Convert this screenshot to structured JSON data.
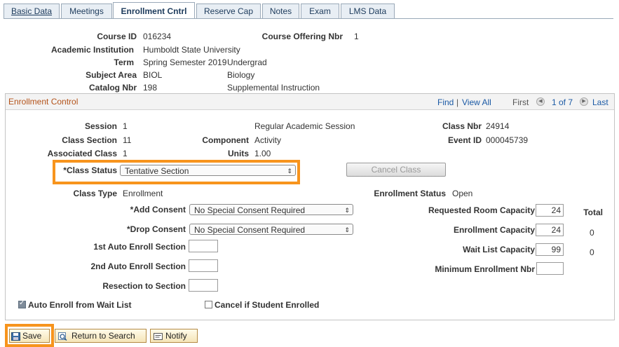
{
  "tabs": [
    "Basic Data",
    "Meetings",
    "Enrollment Cntrl",
    "Reserve Cap",
    "Notes",
    "Exam",
    "LMS Data"
  ],
  "header": {
    "course_id_label": "Course ID",
    "course_id": "016234",
    "offering_label": "Course Offering Nbr",
    "offering": "1",
    "institution_label": "Academic Institution",
    "institution": "Humboldt State University",
    "term_label": "Term",
    "term": "Spring Semester 2019",
    "term_career": "Undergrad",
    "subject_label": "Subject Area",
    "subject": "BIOL",
    "subject_desc": "Biology",
    "catalog_label": "Catalog Nbr",
    "catalog": "198",
    "catalog_desc": "Supplemental Instruction"
  },
  "panel": {
    "title": "Enrollment Control",
    "find": "Find",
    "sep": "|",
    "view_all": "View All",
    "first": "First",
    "range": "1 of 7",
    "last": "Last"
  },
  "fields": {
    "session_label": "Session",
    "session": "1",
    "session_desc": "Regular Academic Session",
    "class_nbr_label": "Class Nbr",
    "class_nbr": "24914",
    "class_section_label": "Class Section",
    "class_section": "11",
    "component_label": "Component",
    "component": "Activity",
    "event_id_label": "Event ID",
    "event_id": "000045739",
    "assoc_class_label": "Associated Class",
    "assoc_class": "1",
    "units_label": "Units",
    "units": "1.00",
    "class_status_label": "*Class Status",
    "class_status": "Tentative Section",
    "cancel_class": "Cancel Class",
    "class_type_label": "Class Type",
    "class_type": "Enrollment",
    "enroll_status_label": "Enrollment Status",
    "enroll_status": "Open",
    "add_consent_label": "*Add Consent",
    "add_consent": "No Special Consent Required",
    "drop_consent_label": "*Drop Consent",
    "drop_consent": "No Special Consent Required",
    "auto1_label": "1st Auto Enroll Section",
    "auto1": "",
    "auto2_label": "2nd Auto Enroll Section",
    "auto2": "",
    "resection_label": "Resection to Section",
    "resection": "",
    "req_room_label": "Requested Room Capacity",
    "req_room": "24",
    "enroll_cap_label": "Enrollment Capacity",
    "enroll_cap": "24",
    "waitlist_label": "Wait List Capacity",
    "waitlist": "99",
    "min_enroll_label": "Minimum Enrollment Nbr",
    "min_enroll": "",
    "total_label": "Total",
    "total_enroll": "0",
    "total_wait": "0",
    "auto_enroll_wait_label": "Auto Enroll from Wait List",
    "auto_enroll_wait_checked": true,
    "cancel_if_label": "Cancel if Student Enrolled",
    "cancel_if_checked": false
  },
  "toolbar": {
    "save": "Save",
    "return": "Return to Search",
    "notify": "Notify"
  },
  "colors": {
    "highlight": "#f7941d",
    "panel_title": "#b4531a",
    "link": "#1b5aa5"
  },
  "icons": [
    "save-icon",
    "search-icon",
    "notify-icon",
    "prev-arrow-icon",
    "next-arrow-icon",
    "dropdown-arrow-icon",
    "checkbox-checked-icon"
  ]
}
